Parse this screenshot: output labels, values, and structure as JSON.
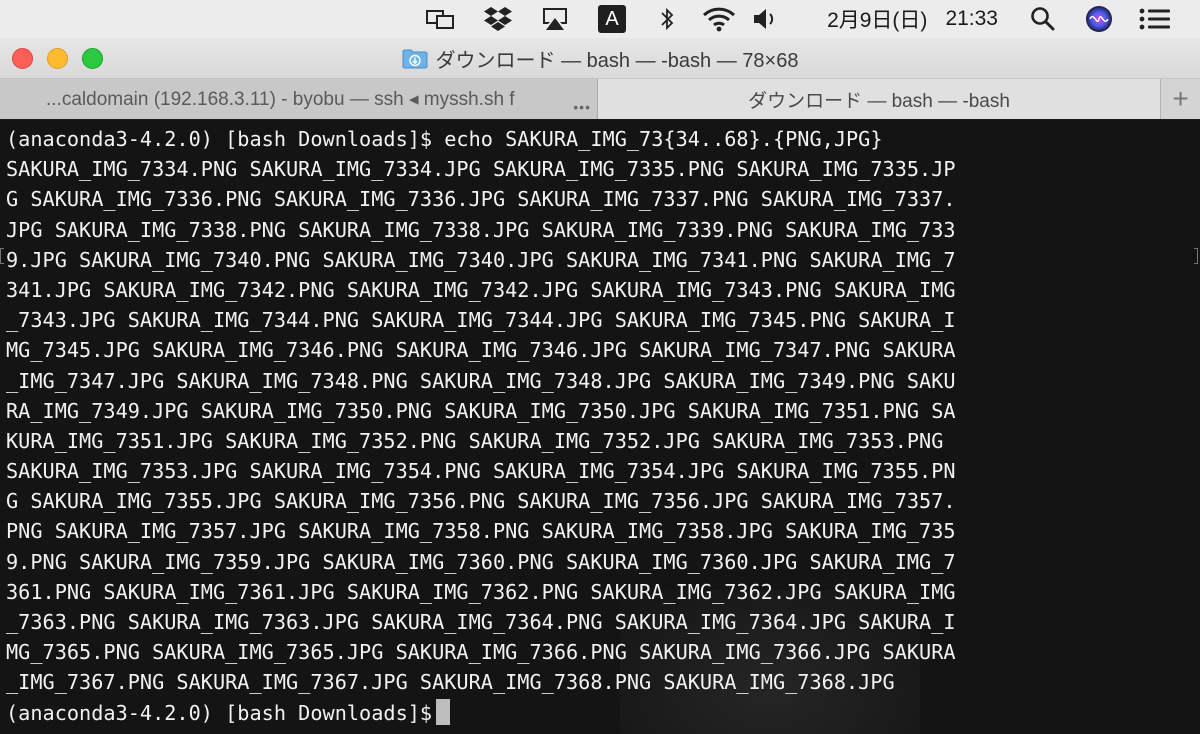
{
  "menubar": {
    "icons": [
      "screen-mirroring-icon",
      "dropbox-icon",
      "airplay-icon",
      "input-method-icon",
      "bluetooth-icon",
      "wifi-icon",
      "volume-icon",
      "spotlight-icon",
      "siri-icon",
      "notification-center-icon"
    ],
    "input_method_letter": "A",
    "date": "2月9日(日)",
    "time": "21:33"
  },
  "window": {
    "title": "ダウンロード — bash — -bash — 78×68",
    "colors": {
      "close": "#fc5f57",
      "minimize": "#fdbb2d",
      "maximize": "#2ac940"
    }
  },
  "tabs": [
    {
      "label": "...caldomain (192.168.3.11) - byobu — ssh ◂ myssh.sh f",
      "active": false
    },
    {
      "label": "ダウンロード — bash — -bash",
      "active": true
    }
  ],
  "tab_add_label": "+",
  "tab_overflow_label": "•••",
  "terminal": {
    "lines": [
      "(anaconda3-4.2.0) [bash Downloads]$ echo SAKURA_IMG_73{34..68}.{PNG,JPG}",
      "SAKURA_IMG_7334.PNG SAKURA_IMG_7334.JPG SAKURA_IMG_7335.PNG SAKURA_IMG_7335.JP",
      "G SAKURA_IMG_7336.PNG SAKURA_IMG_7336.JPG SAKURA_IMG_7337.PNG SAKURA_IMG_7337.",
      "JPG SAKURA_IMG_7338.PNG SAKURA_IMG_7338.JPG SAKURA_IMG_7339.PNG SAKURA_IMG_733",
      "9.JPG SAKURA_IMG_7340.PNG SAKURA_IMG_7340.JPG SAKURA_IMG_7341.PNG SAKURA_IMG_7",
      "341.JPG SAKURA_IMG_7342.PNG SAKURA_IMG_7342.JPG SAKURA_IMG_7343.PNG SAKURA_IMG",
      "_7343.JPG SAKURA_IMG_7344.PNG SAKURA_IMG_7344.JPG SAKURA_IMG_7345.PNG SAKURA_I",
      "MG_7345.JPG SAKURA_IMG_7346.PNG SAKURA_IMG_7346.JPG SAKURA_IMG_7347.PNG SAKURA",
      "_IMG_7347.JPG SAKURA_IMG_7348.PNG SAKURA_IMG_7348.JPG SAKURA_IMG_7349.PNG SAKU",
      "RA_IMG_7349.JPG SAKURA_IMG_7350.PNG SAKURA_IMG_7350.JPG SAKURA_IMG_7351.PNG SA",
      "KURA_IMG_7351.JPG SAKURA_IMG_7352.PNG SAKURA_IMG_7352.JPG SAKURA_IMG_7353.PNG",
      "SAKURA_IMG_7353.JPG SAKURA_IMG_7354.PNG SAKURA_IMG_7354.JPG SAKURA_IMG_7355.PN",
      "G SAKURA_IMG_7355.JPG SAKURA_IMG_7356.PNG SAKURA_IMG_7356.JPG SAKURA_IMG_7357.",
      "PNG SAKURA_IMG_7357.JPG SAKURA_IMG_7358.PNG SAKURA_IMG_7358.JPG SAKURA_IMG_735",
      "9.PNG SAKURA_IMG_7359.JPG SAKURA_IMG_7360.PNG SAKURA_IMG_7360.JPG SAKURA_IMG_7",
      "361.PNG SAKURA_IMG_7361.JPG SAKURA_IMG_7362.PNG SAKURA_IMG_7362.JPG SAKURA_IMG",
      "_7363.PNG SAKURA_IMG_7363.JPG SAKURA_IMG_7364.PNG SAKURA_IMG_7364.JPG SAKURA_I",
      "MG_7365.PNG SAKURA_IMG_7365.JPG SAKURA_IMG_7366.PNG SAKURA_IMG_7366.JPG SAKURA",
      "_IMG_7367.PNG SAKURA_IMG_7367.JPG SAKURA_IMG_7368.PNG SAKURA_IMG_7368.JPG"
    ],
    "prompt": "(anaconda3-4.2.0) [bash Downloads]$"
  }
}
